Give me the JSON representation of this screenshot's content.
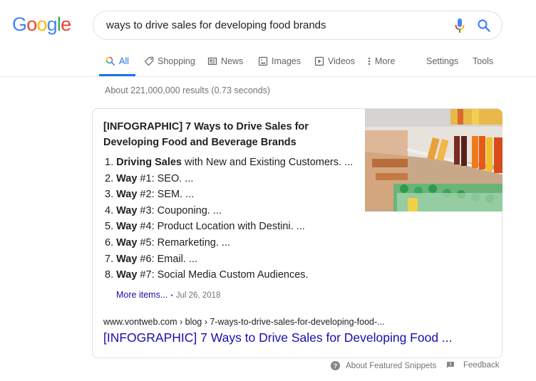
{
  "logo": {
    "letters": [
      {
        "char": "G",
        "color": "#4285f4"
      },
      {
        "char": "o",
        "color": "#ea4335"
      },
      {
        "char": "o",
        "color": "#fbbc05"
      },
      {
        "char": "g",
        "color": "#4285f4"
      },
      {
        "char": "l",
        "color": "#34a853"
      },
      {
        "char": "e",
        "color": "#ea4335"
      }
    ]
  },
  "search": {
    "query": "ways to drive sales for developing food brands",
    "mic_icon": "microphone-icon",
    "search_icon": "search-icon"
  },
  "tabs": [
    {
      "label": "All",
      "icon": "search-icon",
      "active": true
    },
    {
      "label": "Shopping",
      "icon": "tag-icon"
    },
    {
      "label": "News",
      "icon": "newspaper-icon"
    },
    {
      "label": "Images",
      "icon": "image-icon"
    },
    {
      "label": "Videos",
      "icon": "play-icon"
    },
    {
      "label": "More",
      "icon": "more-vert-icon"
    }
  ],
  "tools": {
    "settings": "Settings",
    "tools": "Tools"
  },
  "result_stats": "About 221,000,000 results (0.73 seconds)",
  "featured_snippet": {
    "title": "[INFOGRAPHIC] 7 Ways to Drive Sales for Developing Food and Beverage Brands",
    "items": [
      {
        "num": "1.",
        "bold": "Driving Sales",
        "rest": " with New and Existing Customers. ..."
      },
      {
        "num": "2.",
        "bold": "Way",
        "rest": " #1: SEO. ..."
      },
      {
        "num": "3.",
        "bold": "Way",
        "rest": " #2: SEM. ..."
      },
      {
        "num": "4.",
        "bold": "Way",
        "rest": " #3: Couponing. ..."
      },
      {
        "num": "5.",
        "bold": "Way",
        "rest": " #4: Product Location with Destini. ..."
      },
      {
        "num": "6.",
        "bold": "Way",
        "rest": " #5: Remarketing. ..."
      },
      {
        "num": "7.",
        "bold": "Way",
        "rest": " #6: Email. ..."
      },
      {
        "num": "8.",
        "bold": "Way",
        "rest": " #7: Social Media Custom Audiences."
      }
    ],
    "more_items": "More items...",
    "separator": "•",
    "date": "Jul 26, 2018",
    "cite": "www.vontweb.com › blog › 7-ways-to-drive-sales-for-developing-food-...",
    "link_title": "[INFOGRAPHIC] 7 Ways to Drive Sales for Developing Food ...",
    "image_alt": "supermarket shelves with drinks"
  },
  "footer": {
    "about": "About Featured Snippets",
    "feedback": "Feedback"
  },
  "colors": {
    "accent": "#1a73e8",
    "link": "#1a0dab",
    "muted": "#70757a"
  }
}
